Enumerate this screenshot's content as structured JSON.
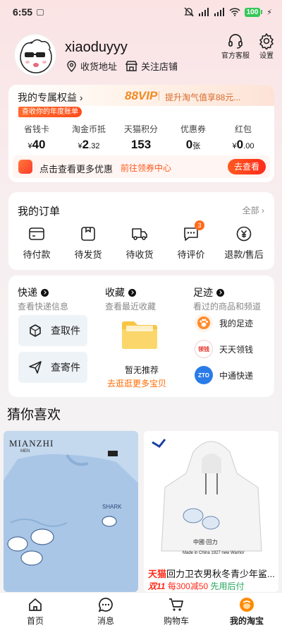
{
  "status_bar": {
    "time": "6:55",
    "battery": "100"
  },
  "profile": {
    "username": "xiaoduyyy",
    "address_link": "收货地址",
    "followed_shops_link": "关注店铺",
    "customer_service": "官方客服",
    "settings": "设置"
  },
  "benefits": {
    "title": "我的专属权益",
    "vip_level": "88VIP",
    "vip_pitch": "提升淘气值享88元...",
    "year_report": "查收你的年度账单",
    "items": [
      {
        "label": "省钱卡",
        "prefix": "¥",
        "value": "40",
        "suffix": ""
      },
      {
        "label": "淘金币抵",
        "prefix": "¥",
        "value": "2",
        "suffix": ".32"
      },
      {
        "label": "天猫积分",
        "prefix": "",
        "value": "153",
        "suffix": ""
      },
      {
        "label": "优惠券",
        "prefix": "",
        "value": "0",
        "suffix": "张"
      },
      {
        "label": "红包",
        "prefix": "¥",
        "value": "0",
        "suffix": ".00"
      }
    ],
    "promo_text": "点击查看更多优惠",
    "promo_link": "前往领券中心",
    "promo_button": "去查看"
  },
  "orders": {
    "title": "我的订单",
    "all_link": "全部",
    "items": [
      {
        "label": "待付款",
        "icon": "wallet-icon",
        "badge": ""
      },
      {
        "label": "待发货",
        "icon": "package-icon",
        "badge": ""
      },
      {
        "label": "待收货",
        "icon": "truck-icon",
        "badge": ""
      },
      {
        "label": "待评价",
        "icon": "comment-icon",
        "badge": "3"
      },
      {
        "label": "退款/售后",
        "icon": "refund-icon",
        "badge": ""
      }
    ]
  },
  "express": {
    "title": "快递",
    "subtitle": "查看快递信息",
    "pickup": "查取件",
    "send": "查寄件"
  },
  "favorites": {
    "title": "收藏",
    "subtitle": "查看最近收藏",
    "empty": "暂无推荐",
    "go": "去逛逛更多宝贝"
  },
  "footprints": {
    "title": "足迹",
    "subtitle": "看过的商品和频道",
    "items": [
      {
        "label": "我的足迹",
        "color": "#ff8a2a",
        "icon": "paw-icon",
        "logo_text": ""
      },
      {
        "label": "天天领钱",
        "color": "#ffffff",
        "icon": "daily-cash-icon",
        "logo_text": "领钱"
      },
      {
        "label": "中通快递",
        "color": "#2a7be8",
        "icon": "zto-icon",
        "logo_text": "ZTO"
      }
    ]
  },
  "recommend": {
    "title": "猜你喜欢",
    "products": [
      {
        "brand": "MIANZHI",
        "brand_sub": "MEN",
        "title_tag": "",
        "title": "",
        "promo_tag": "",
        "promo_deal": "",
        "promo_later": ""
      },
      {
        "brand": "",
        "brand_sub": "",
        "title_tag": "天猫",
        "title": "回力卫衣男秋冬青少年鲨...",
        "promo_tag": "双11",
        "promo_deal": "每300减50",
        "promo_later": "先用后付"
      }
    ]
  },
  "tabbar": {
    "items": [
      {
        "label": "首页",
        "icon": "home-icon"
      },
      {
        "label": "消息",
        "icon": "message-icon"
      },
      {
        "label": "购物车",
        "icon": "cart-icon"
      },
      {
        "label": "我的淘宝",
        "icon": "my-taobao-icon"
      }
    ]
  },
  "colors": {
    "accent": "#ff5a1f",
    "vip": "#f08a24",
    "active_tab": "#ff8a00"
  }
}
